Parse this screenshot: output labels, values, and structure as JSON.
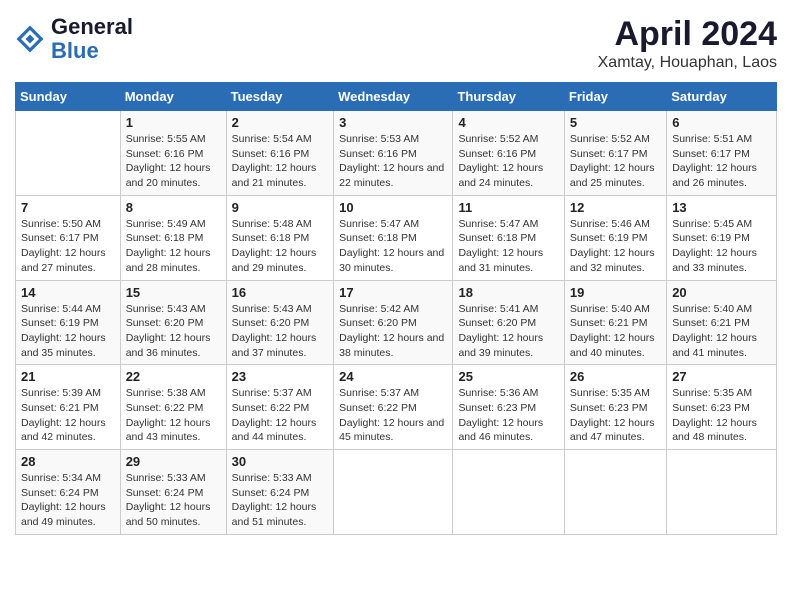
{
  "logo": {
    "line1": "General",
    "line2": "Blue"
  },
  "title": "April 2024",
  "subtitle": "Xamtay, Houaphan, Laos",
  "days_of_week": [
    "Sunday",
    "Monday",
    "Tuesday",
    "Wednesday",
    "Thursday",
    "Friday",
    "Saturday"
  ],
  "weeks": [
    [
      {
        "day": "",
        "sunrise": "",
        "sunset": "",
        "daylight": ""
      },
      {
        "day": "1",
        "sunrise": "Sunrise: 5:55 AM",
        "sunset": "Sunset: 6:16 PM",
        "daylight": "Daylight: 12 hours and 20 minutes."
      },
      {
        "day": "2",
        "sunrise": "Sunrise: 5:54 AM",
        "sunset": "Sunset: 6:16 PM",
        "daylight": "Daylight: 12 hours and 21 minutes."
      },
      {
        "day": "3",
        "sunrise": "Sunrise: 5:53 AM",
        "sunset": "Sunset: 6:16 PM",
        "daylight": "Daylight: 12 hours and 22 minutes."
      },
      {
        "day": "4",
        "sunrise": "Sunrise: 5:52 AM",
        "sunset": "Sunset: 6:16 PM",
        "daylight": "Daylight: 12 hours and 24 minutes."
      },
      {
        "day": "5",
        "sunrise": "Sunrise: 5:52 AM",
        "sunset": "Sunset: 6:17 PM",
        "daylight": "Daylight: 12 hours and 25 minutes."
      },
      {
        "day": "6",
        "sunrise": "Sunrise: 5:51 AM",
        "sunset": "Sunset: 6:17 PM",
        "daylight": "Daylight: 12 hours and 26 minutes."
      }
    ],
    [
      {
        "day": "7",
        "sunrise": "Sunrise: 5:50 AM",
        "sunset": "Sunset: 6:17 PM",
        "daylight": "Daylight: 12 hours and 27 minutes."
      },
      {
        "day": "8",
        "sunrise": "Sunrise: 5:49 AM",
        "sunset": "Sunset: 6:18 PM",
        "daylight": "Daylight: 12 hours and 28 minutes."
      },
      {
        "day": "9",
        "sunrise": "Sunrise: 5:48 AM",
        "sunset": "Sunset: 6:18 PM",
        "daylight": "Daylight: 12 hours and 29 minutes."
      },
      {
        "day": "10",
        "sunrise": "Sunrise: 5:47 AM",
        "sunset": "Sunset: 6:18 PM",
        "daylight": "Daylight: 12 hours and 30 minutes."
      },
      {
        "day": "11",
        "sunrise": "Sunrise: 5:47 AM",
        "sunset": "Sunset: 6:18 PM",
        "daylight": "Daylight: 12 hours and 31 minutes."
      },
      {
        "day": "12",
        "sunrise": "Sunrise: 5:46 AM",
        "sunset": "Sunset: 6:19 PM",
        "daylight": "Daylight: 12 hours and 32 minutes."
      },
      {
        "day": "13",
        "sunrise": "Sunrise: 5:45 AM",
        "sunset": "Sunset: 6:19 PM",
        "daylight": "Daylight: 12 hours and 33 minutes."
      }
    ],
    [
      {
        "day": "14",
        "sunrise": "Sunrise: 5:44 AM",
        "sunset": "Sunset: 6:19 PM",
        "daylight": "Daylight: 12 hours and 35 minutes."
      },
      {
        "day": "15",
        "sunrise": "Sunrise: 5:43 AM",
        "sunset": "Sunset: 6:20 PM",
        "daylight": "Daylight: 12 hours and 36 minutes."
      },
      {
        "day": "16",
        "sunrise": "Sunrise: 5:43 AM",
        "sunset": "Sunset: 6:20 PM",
        "daylight": "Daylight: 12 hours and 37 minutes."
      },
      {
        "day": "17",
        "sunrise": "Sunrise: 5:42 AM",
        "sunset": "Sunset: 6:20 PM",
        "daylight": "Daylight: 12 hours and 38 minutes."
      },
      {
        "day": "18",
        "sunrise": "Sunrise: 5:41 AM",
        "sunset": "Sunset: 6:20 PM",
        "daylight": "Daylight: 12 hours and 39 minutes."
      },
      {
        "day": "19",
        "sunrise": "Sunrise: 5:40 AM",
        "sunset": "Sunset: 6:21 PM",
        "daylight": "Daylight: 12 hours and 40 minutes."
      },
      {
        "day": "20",
        "sunrise": "Sunrise: 5:40 AM",
        "sunset": "Sunset: 6:21 PM",
        "daylight": "Daylight: 12 hours and 41 minutes."
      }
    ],
    [
      {
        "day": "21",
        "sunrise": "Sunrise: 5:39 AM",
        "sunset": "Sunset: 6:21 PM",
        "daylight": "Daylight: 12 hours and 42 minutes."
      },
      {
        "day": "22",
        "sunrise": "Sunrise: 5:38 AM",
        "sunset": "Sunset: 6:22 PM",
        "daylight": "Daylight: 12 hours and 43 minutes."
      },
      {
        "day": "23",
        "sunrise": "Sunrise: 5:37 AM",
        "sunset": "Sunset: 6:22 PM",
        "daylight": "Daylight: 12 hours and 44 minutes."
      },
      {
        "day": "24",
        "sunrise": "Sunrise: 5:37 AM",
        "sunset": "Sunset: 6:22 PM",
        "daylight": "Daylight: 12 hours and 45 minutes."
      },
      {
        "day": "25",
        "sunrise": "Sunrise: 5:36 AM",
        "sunset": "Sunset: 6:23 PM",
        "daylight": "Daylight: 12 hours and 46 minutes."
      },
      {
        "day": "26",
        "sunrise": "Sunrise: 5:35 AM",
        "sunset": "Sunset: 6:23 PM",
        "daylight": "Daylight: 12 hours and 47 minutes."
      },
      {
        "day": "27",
        "sunrise": "Sunrise: 5:35 AM",
        "sunset": "Sunset: 6:23 PM",
        "daylight": "Daylight: 12 hours and 48 minutes."
      }
    ],
    [
      {
        "day": "28",
        "sunrise": "Sunrise: 5:34 AM",
        "sunset": "Sunset: 6:24 PM",
        "daylight": "Daylight: 12 hours and 49 minutes."
      },
      {
        "day": "29",
        "sunrise": "Sunrise: 5:33 AM",
        "sunset": "Sunset: 6:24 PM",
        "daylight": "Daylight: 12 hours and 50 minutes."
      },
      {
        "day": "30",
        "sunrise": "Sunrise: 5:33 AM",
        "sunset": "Sunset: 6:24 PM",
        "daylight": "Daylight: 12 hours and 51 minutes."
      },
      {
        "day": "",
        "sunrise": "",
        "sunset": "",
        "daylight": ""
      },
      {
        "day": "",
        "sunrise": "",
        "sunset": "",
        "daylight": ""
      },
      {
        "day": "",
        "sunrise": "",
        "sunset": "",
        "daylight": ""
      },
      {
        "day": "",
        "sunrise": "",
        "sunset": "",
        "daylight": ""
      }
    ]
  ]
}
